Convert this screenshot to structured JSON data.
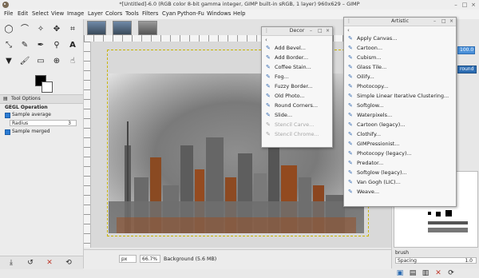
{
  "window": {
    "title": "*[Untitled]-6.0 (RGB color 8-bit gamma integer, GIMP built-in sRGB, 1 layer) 960x629 – GIMP"
  },
  "menubar": [
    "File",
    "Edit",
    "Select",
    "View",
    "Image",
    "Layer",
    "Colors",
    "Tools",
    "Filters",
    "Cyan",
    "Python-Fu",
    "Windows",
    "Help"
  ],
  "toolbox": {
    "tool_options_tab": "Tool Options",
    "gegl_label": "GEGL Operation",
    "sample_average": "Sample average",
    "radius_label": "Radius",
    "radius_value": "3",
    "sample_merged": "Sample merged"
  },
  "statusbar": {
    "unit": "px",
    "zoom": "66.7%",
    "info": "Background (5.6 MB)"
  },
  "right_dock": {
    "field_value": "100.0",
    "round_label": "round",
    "brush_name": "brush",
    "spacing_label": "Spacing",
    "spacing_value": "1.0"
  },
  "decor_menu": {
    "title": "Decor",
    "items": [
      {
        "label": "Add Bevel...",
        "enabled": true
      },
      {
        "label": "Add Border...",
        "enabled": true
      },
      {
        "label": "Coffee Stain...",
        "enabled": true
      },
      {
        "label": "Fog...",
        "enabled": true
      },
      {
        "label": "Fuzzy Border...",
        "enabled": true
      },
      {
        "label": "Old Photo...",
        "enabled": true
      },
      {
        "label": "Round Corners...",
        "enabled": true
      },
      {
        "label": "Slide...",
        "enabled": true
      },
      {
        "label": "Stencil Carve...",
        "enabled": false
      },
      {
        "label": "Stencil Chrome...",
        "enabled": false
      }
    ]
  },
  "artistic_menu": {
    "title": "Artistic",
    "items": [
      {
        "label": "Apply Canvas...",
        "enabled": true
      },
      {
        "label": "Cartoon...",
        "enabled": true
      },
      {
        "label": "Cubism...",
        "enabled": true
      },
      {
        "label": "Glass Tile...",
        "enabled": true
      },
      {
        "label": "Oilify...",
        "enabled": true
      },
      {
        "label": "Photocopy...",
        "enabled": true
      },
      {
        "label": "Simple Linear Iterative Clustering...",
        "enabled": true
      },
      {
        "label": "Softglow...",
        "enabled": true
      },
      {
        "label": "Waterpixels...",
        "enabled": true
      },
      {
        "label": "Cartoon (legacy)...",
        "enabled": true
      },
      {
        "label": "Clothify...",
        "enabled": true
      },
      {
        "label": "GIMPressionist...",
        "enabled": true
      },
      {
        "label": "Photocopy (legacy)...",
        "enabled": true
      },
      {
        "label": "Predator...",
        "enabled": true
      },
      {
        "label": "Softglow (legacy)...",
        "enabled": true
      },
      {
        "label": "Van Gogh (LIC)...",
        "enabled": true
      },
      {
        "label": "Weave...",
        "enabled": true
      }
    ]
  },
  "colors": {
    "menu_icon": "#3b6fb3",
    "selection_dash": "#c9b400",
    "checkbox": "#2c7cd3",
    "rust_tint": "#9a4a1c"
  },
  "icons": [
    "gimp-logo-icon",
    "minimize-icon",
    "maximize-icon",
    "close-icon",
    "back-arrow-icon",
    "filter-icon"
  ]
}
